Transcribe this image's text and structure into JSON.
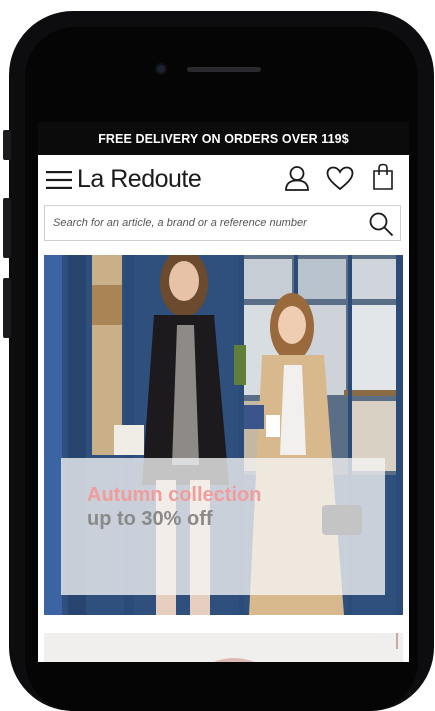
{
  "promo": {
    "text": "FREE DELIVERY ON ORDERS OVER 119$"
  },
  "header": {
    "logo": "La Redoute",
    "icons": [
      "menu-icon",
      "account-icon",
      "wishlist-heart-icon",
      "shopping-bag-icon"
    ]
  },
  "search": {
    "placeholder": "Search for an article, a brand or a reference number",
    "icon": "search-icon"
  },
  "hero": {
    "title": "Autumn collection",
    "subtitle": "up to 30% off"
  },
  "colors": {
    "promo_bg": "#0b0b0b",
    "hero_title": "#f29c9c",
    "hero_subtitle": "#8a8a8a",
    "storefront_blue": "#2f4f7c"
  }
}
